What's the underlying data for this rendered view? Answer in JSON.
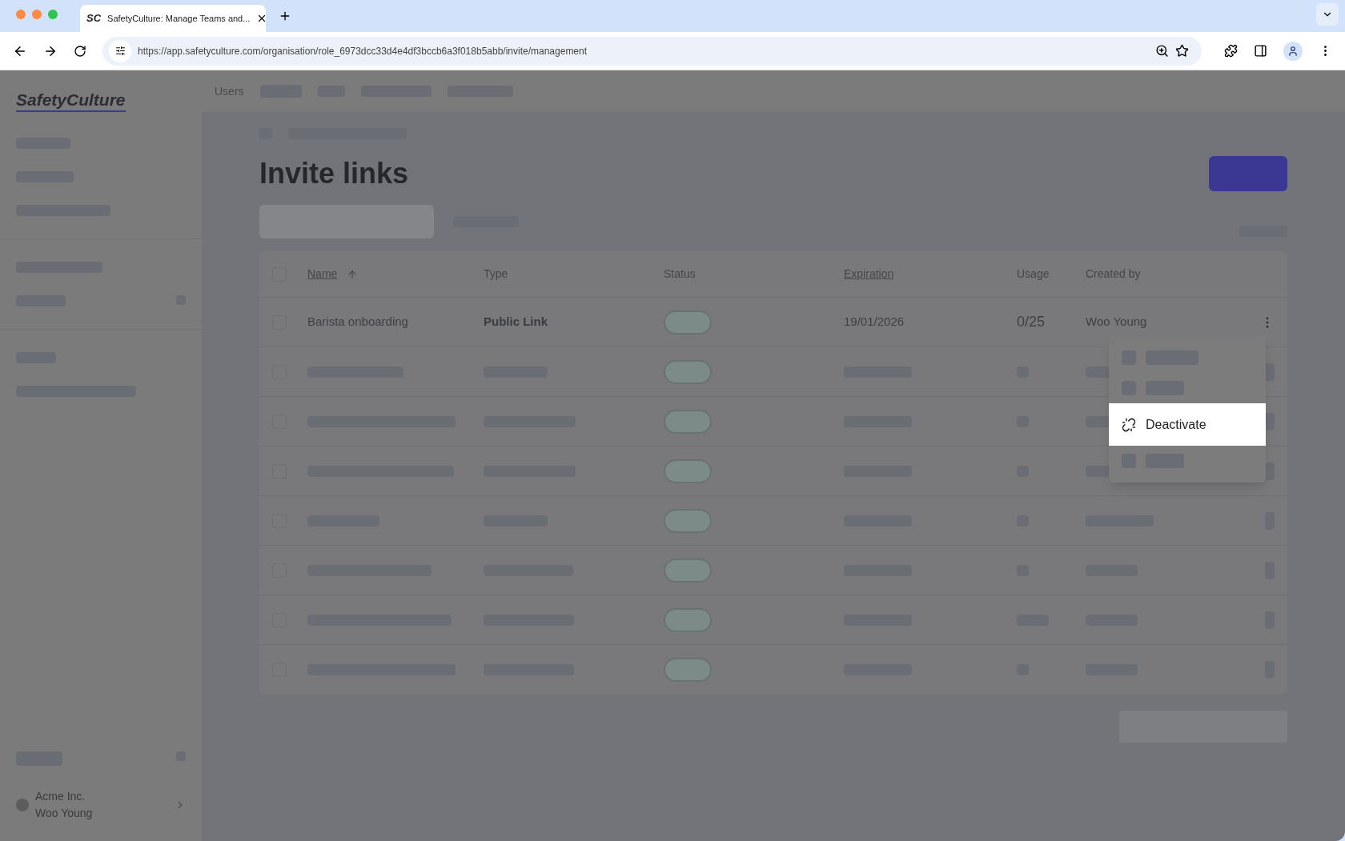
{
  "browser": {
    "tab_title": "SafetyCulture: Manage Teams and...",
    "tab_logo": "SC",
    "url": "https://app.safetyculture.com/organisation/role_6973dcc33d4e4df3bccb6a3f018b5abb/invite/management"
  },
  "brand": "SafetyCulture",
  "top_nav": {
    "items": [
      "Users"
    ]
  },
  "page": {
    "title": "Invite links"
  },
  "table": {
    "columns": [
      {
        "label": "Name",
        "sortable": true
      },
      {
        "label": "Type",
        "sortable": false
      },
      {
        "label": "Status",
        "sortable": false
      },
      {
        "label": "Expiration",
        "sortable": true
      },
      {
        "label": "Usage",
        "sortable": false
      },
      {
        "label": "Created by",
        "sortable": false
      }
    ],
    "select_all": {
      "checked": false
    },
    "rows": [
      {
        "checked": false,
        "name": "Barista onboarding",
        "type": "Public Link",
        "expiration": "19/01/2026",
        "usage": "0/25",
        "created_by": "Woo Young"
      }
    ],
    "redacted_rows": [
      {
        "checked": false
      },
      {
        "checked": false
      },
      {
        "checked": false
      },
      {
        "checked": false
      },
      {
        "checked": false
      },
      {
        "checked": false
      },
      {
        "checked": false
      }
    ]
  },
  "menu": {
    "items": [
      {
        "kind": "redacted"
      },
      {
        "kind": "redacted"
      },
      {
        "kind": "action",
        "label": "Deactivate",
        "highlighted": true
      },
      {
        "kind": "redacted"
      }
    ]
  },
  "account": {
    "org": "Acme Inc.",
    "user": "Woo Young"
  }
}
